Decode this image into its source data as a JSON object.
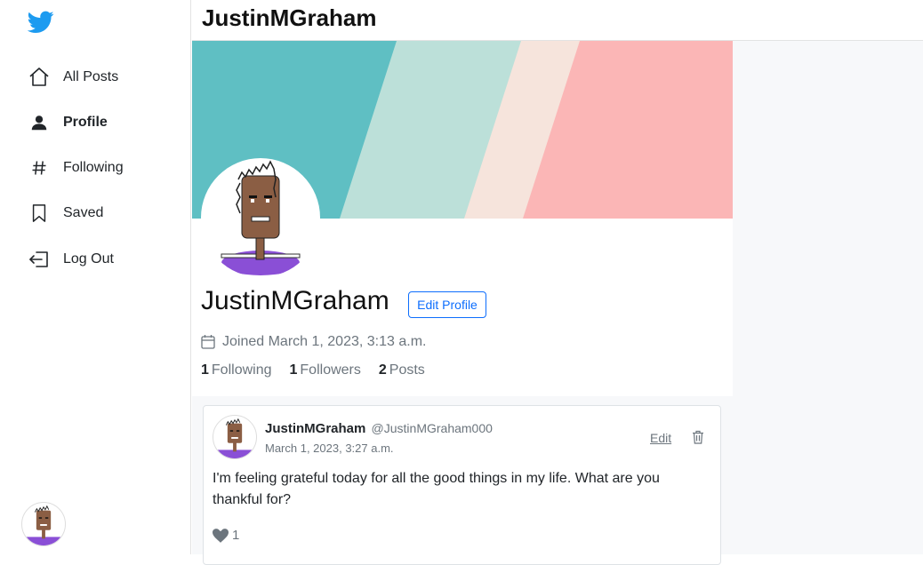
{
  "sidebar": {
    "items": [
      {
        "label": "All Posts",
        "icon": "home-icon"
      },
      {
        "label": "Profile",
        "icon": "person-icon"
      },
      {
        "label": "Following",
        "icon": "hash-icon"
      },
      {
        "label": "Saved",
        "icon": "bookmark-icon"
      },
      {
        "label": "Log Out",
        "icon": "logout-icon"
      }
    ],
    "active_item": "Profile"
  },
  "header": {
    "title": "JustinMGraham"
  },
  "profile": {
    "name": "JustinMGraham",
    "edit_label": "Edit Profile",
    "joined": "Joined March 1, 2023, 3:13 a.m.",
    "following_count": "1",
    "following_label": "Following",
    "followers_count": "1",
    "followers_label": "Followers",
    "posts_count": "2",
    "posts_label": "Posts"
  },
  "post": {
    "author": "JustinMGraham",
    "handle": "@JustinMGraham000",
    "date": "March 1, 2023, 3:27 a.m.",
    "edit_label": "Edit",
    "body": "I'm feeling grateful today for all the good things in my life. What are you thankful for?",
    "likes": "1"
  },
  "colors": {
    "accent": "#0d6efd",
    "twitter_blue": "#1d9bf0",
    "banner_teal": "#5fbfc3",
    "banner_mint": "#bce0d9",
    "banner_cream": "#f6e4dc",
    "banner_pink": "#fbb6b6",
    "avatar_shirt": "#8a4fd6",
    "avatar_skin": "#8b5e44"
  }
}
